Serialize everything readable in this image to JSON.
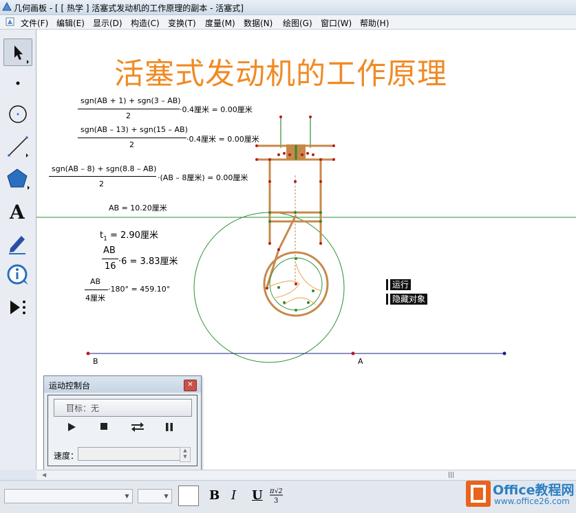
{
  "window": {
    "title": "几何画板 - [ [ 热学 ] 活塞式发动机的工作原理的副本 - 活塞式]"
  },
  "menu": {
    "items": [
      "文件(F)",
      "编辑(E)",
      "显示(D)",
      "构造(C)",
      "变换(T)",
      "度量(M)",
      "数据(N)",
      "绘图(G)",
      "窗口(W)",
      "帮助(H)"
    ]
  },
  "toolbar": {
    "tools": [
      "arrow-select-tool",
      "point-tool",
      "compass-tool",
      "straightedge-tool",
      "polygon-tool",
      "text-tool",
      "marker-tool",
      "information-tool",
      "custom-tool"
    ]
  },
  "canvas": {
    "heading": "活塞式发动机的工作原理",
    "formulas": {
      "f1_num": "sgn(AB + 1) + sgn(3 – AB)",
      "f1_den": "2",
      "f1_rest": "·0.4厘米 = 0.00厘米",
      "f2_num": "sgn(AB – 13) + sgn(15 – AB)",
      "f2_den": "2",
      "f2_rest": "·0.4厘米 = 0.00厘米",
      "f3_num": "sgn(AB – 8) + sgn(8.8 – AB)",
      "f3_den": "2",
      "f3_rest": "·(AB – 8厘米) = 0.00厘米",
      "ab_measure": "AB = 10.20厘米",
      "t1_base": "t",
      "t1_sub": "1",
      "t1_rest": " = 2.90厘米",
      "f5_num": "AB",
      "f5_den": "16",
      "f5_rest": "·6 = 3.83厘米",
      "f6_num": "AB",
      "f6_den": "4厘米",
      "f6_rest": "·180° = 459.10°"
    },
    "buttons": {
      "run": "运行",
      "hide": "隐藏对象"
    },
    "points": {
      "b": "B",
      "a": "A"
    },
    "colors": {
      "heading": "#f08a24",
      "mechanism": "#c8884a",
      "green": "#2e8b2e",
      "navy": "#1a237e",
      "point": "#b71c1c"
    }
  },
  "motion_panel": {
    "title": "运动控制台",
    "target": "目标：无",
    "target_dash": "—",
    "speed_label": "速度：",
    "controls": [
      "play",
      "stop",
      "reverse",
      "pause"
    ]
  },
  "format_bar": {
    "bold": "B",
    "italic": "I",
    "underline": "U"
  },
  "watermark": {
    "brand": "Office教程网",
    "url": "www.office26.com"
  }
}
